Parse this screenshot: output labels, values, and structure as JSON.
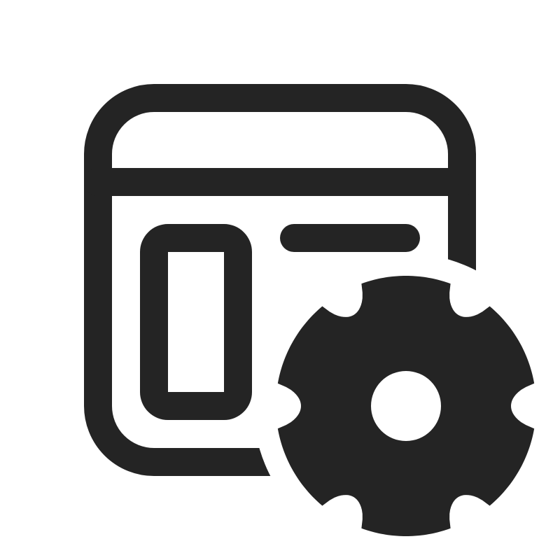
{
  "icon": {
    "name": "window-settings-icon",
    "parts": [
      "window-frame-icon",
      "sidebar-panel-icon",
      "content-line-icon",
      "gear-icon"
    ],
    "color": "#242424",
    "background": "#ffffff"
  }
}
